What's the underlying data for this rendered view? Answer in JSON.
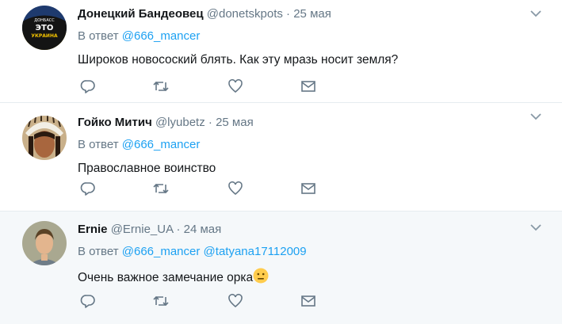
{
  "tweets": [
    {
      "name": "Донецкий Бандеовец",
      "handle": "@donetskpots",
      "dot": "·",
      "time": "25 мая",
      "reply_prefix": "В ответ",
      "reply_users": [
        "@666_mancer"
      ],
      "text": "Широков новосоский блять. Как эту мразь носит земля?",
      "avatar_text": [
        "ДОНБАСС",
        "ЭТО",
        "УКРАИНА"
      ]
    },
    {
      "name": "Гойко Митич",
      "handle": "@lyubetz",
      "dot": "·",
      "time": "25 мая",
      "reply_prefix": "В ответ",
      "reply_users": [
        "@666_mancer"
      ],
      "text": "Православное воинство"
    },
    {
      "name": "Ernie",
      "handle": "@Ernie_UA",
      "dot": "·",
      "time": "24 мая",
      "reply_prefix": "В ответ",
      "reply_users": [
        "@666_mancer",
        "@tatyana17112009"
      ],
      "text": "Очень важное замечание орка",
      "text_emoji": "neutral-face-emoji"
    }
  ],
  "icons": {
    "reply": "reply-icon",
    "retweet": "retweet-icon",
    "like": "heart-icon",
    "dm": "envelope-icon",
    "more": "chevron-down-icon"
  },
  "colors": {
    "text": "#14171a",
    "secondary": "#657786",
    "link": "#1da1f2",
    "hover_bg": "#f5f8fa",
    "divider": "#e6ecf0"
  }
}
